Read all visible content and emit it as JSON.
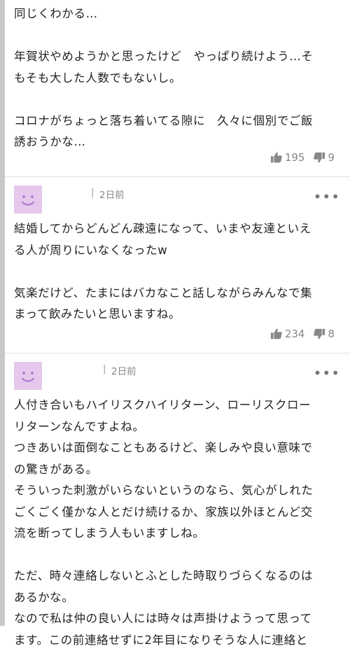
{
  "comments": [
    {
      "lines": [
        "同じくわかる…",
        "",
        "年賀状やめようかと思ったけど　やっぱり続けよう…そ",
        "もそも大した人数でもないし。",
        "",
        "コロナがちょっと落ち着いてる隙に　久々に個別でご飯",
        "誘おうかな…"
      ],
      "likes": "195",
      "dislikes": "9"
    },
    {
      "user": "",
      "separator": "|",
      "time_ago": "2日前",
      "more": "•••",
      "lines": [
        "結婚してからどんどん疎遠になって、いまや友達といえ",
        "る人が周りにいなくなったw",
        "",
        "気楽だけど、たまにはバカなこと話しながらみんなで集",
        "まって飲みたいと思いますね。"
      ],
      "likes": "234",
      "dislikes": "8"
    },
    {
      "user": "",
      "separator": "|",
      "time_ago": "2日前",
      "more": "•••",
      "lines": [
        "人付き合いもハイリスクハイリターン、ローリスクロー",
        "リターンなんですよね。",
        "つきあいは面倒なこともあるけど、楽しみや良い意味で",
        "の驚きがある。",
        "そういった刺激がいらないというのなら、気心がしれた",
        "ごくごく僅かな人とだけ続けるか、家族以外ほとんど交",
        "流を断ってしまう人もいますしね。",
        "",
        "ただ、時々連絡しないとふとした時取りづらくなるのは",
        "あるかな。",
        "なので私は仲の良い人には時々は声掛けようって思って",
        "ます。この前連絡せずに2年目になりそうな人に連絡と"
      ]
    }
  ],
  "colors": {
    "avatar_bg": "#e6c8ec",
    "avatar_face": "#b07bd0",
    "rail": "#c9c9c9",
    "meta": "#888888"
  },
  "icons": {
    "like": "thumbs-up-icon",
    "dislike": "thumbs-down-icon",
    "more": "more-icon"
  }
}
